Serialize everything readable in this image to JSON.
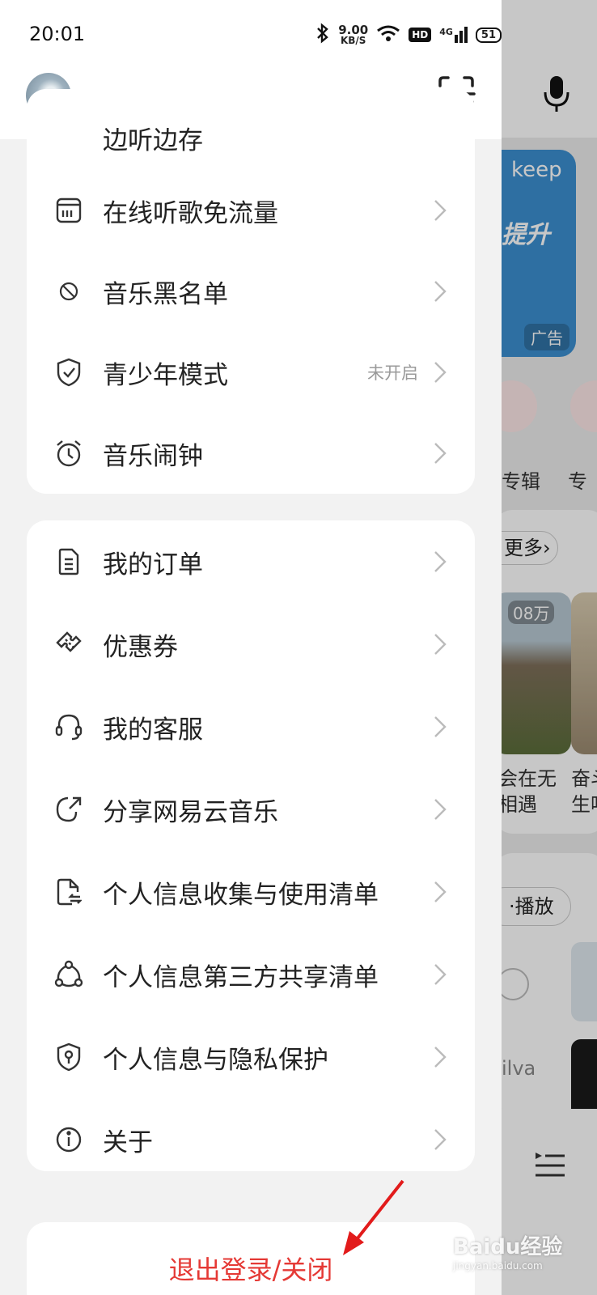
{
  "status_bar": {
    "time": "20:01",
    "net_speed": "9.00",
    "net_unit": "KB/S",
    "hd": "HD",
    "signal": "4G",
    "battery": "51"
  },
  "drawer": {
    "partial_item_label": "边听边存",
    "group1": [
      {
        "label": "在线听歌免流量",
        "icon": "sim-card-icon",
        "status": ""
      },
      {
        "label": "音乐黑名单",
        "icon": "block-icon",
        "status": ""
      },
      {
        "label": "青少年模式",
        "icon": "shield-check-icon",
        "status": "未开启"
      },
      {
        "label": "音乐闹钟",
        "icon": "alarm-clock-icon",
        "status": ""
      }
    ],
    "group2": [
      {
        "label": "我的订单",
        "icon": "document-icon"
      },
      {
        "label": "优惠券",
        "icon": "ticket-icon"
      },
      {
        "label": "我的客服",
        "icon": "headset-icon"
      },
      {
        "label": "分享网易云音乐",
        "icon": "share-icon"
      },
      {
        "label": "个人信息收集与使用清单",
        "icon": "file-sync-icon"
      },
      {
        "label": "个人信息第三方共享清单",
        "icon": "network-share-icon"
      },
      {
        "label": "个人信息与隐私保护",
        "icon": "privacy-shield-icon"
      },
      {
        "label": "关于",
        "icon": "info-icon"
      }
    ],
    "logout_label": "退出登录/关闭"
  },
  "background": {
    "ad_brand": "keep",
    "ad_slogan": "提升",
    "ad_badge": "广告",
    "category_1": "专辑",
    "category_2": "专",
    "more_label": "更多",
    "play_count": "08万",
    "playlist_title_line1": "会在无",
    "playlist_title_line2": "相遇",
    "playlist2_title_line1": "奋斗",
    "playlist2_title_line2": "生吧",
    "play_all": "播放",
    "artist_fragment": "ilva"
  },
  "watermark": {
    "text": "Baidu经验",
    "sub": "jingyan.baidu.com"
  },
  "colors": {
    "accent_red": "#e53935",
    "text_primary": "#222222",
    "text_secondary": "#9a9a9a"
  }
}
